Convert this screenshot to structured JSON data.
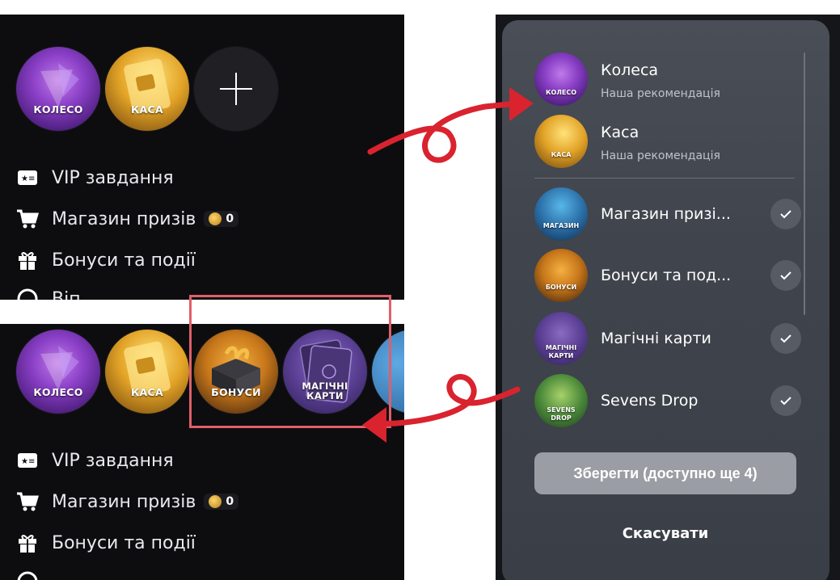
{
  "left_top": {
    "shortcuts": [
      {
        "label": "КОЛЕСО",
        "icon": "wheel-icon"
      },
      {
        "label": "КАСА",
        "icon": "cash-card-icon"
      }
    ],
    "add_icon": "plus-icon",
    "menu": [
      {
        "label": "VIP завдання",
        "icon": "vip-ticket-icon"
      },
      {
        "label": "Магазин призів",
        "icon": "cart-icon",
        "badge": "0"
      },
      {
        "label": "Бонуси та події",
        "icon": "gift-icon"
      },
      {
        "label": "Віп...",
        "icon": "coin-icon"
      }
    ]
  },
  "left_bottom": {
    "shortcuts": [
      {
        "label": "КОЛЕСО",
        "icon": "wheel-icon"
      },
      {
        "label": "КАСА",
        "icon": "cash-card-icon"
      },
      {
        "label": "БОНУСИ",
        "icon": "bonus-gift-icon"
      },
      {
        "label": "МАГІЧНІ КАРТИ",
        "icon": "magic-cards-icon"
      }
    ],
    "menu": [
      {
        "label": "VIP завдання",
        "icon": "vip-ticket-icon"
      },
      {
        "label": "Магазин призів",
        "icon": "cart-icon",
        "badge": "0"
      },
      {
        "label": "Бонуси та події",
        "icon": "gift-icon"
      }
    ]
  },
  "modal": {
    "recommended": [
      {
        "title": "Колеса",
        "subtitle": "Наша рекомендація",
        "icon_label": "КОЛЕСО"
      },
      {
        "title": "Каса",
        "subtitle": "Наша рекомендація",
        "icon_label": "КАСА"
      }
    ],
    "selected": [
      {
        "title": "Магазин призі...",
        "icon_label": "МАГАЗИН",
        "checked": true
      },
      {
        "title": "Бонуси та под...",
        "icon_label": "БОНУСИ",
        "checked": true
      },
      {
        "title": "Магічні карти",
        "icon_label": "МАГІЧНІ КАРТИ",
        "checked": true
      },
      {
        "title": "Sevens Drop",
        "icon_label": "SEVENS DROP",
        "checked": true
      }
    ],
    "save_label": "Зберегти (доступно ще 4)",
    "cancel_label": "Скасувати"
  },
  "colors": {
    "annotation_red": "#d9232f",
    "highlight_box": "#e05f69"
  }
}
